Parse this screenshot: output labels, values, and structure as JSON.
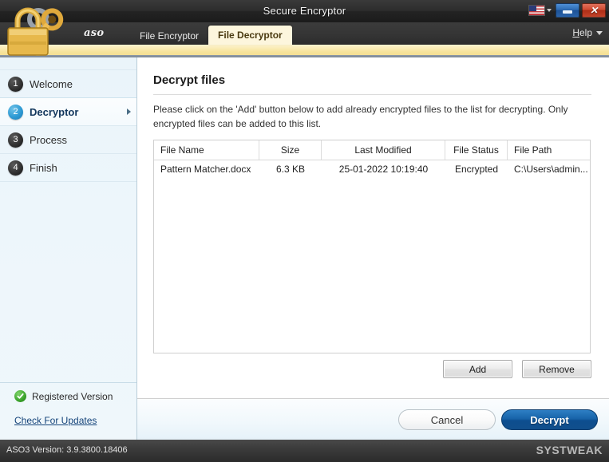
{
  "window": {
    "title": "Secure Encryptor",
    "minimize_label": "–",
    "close_label": "✕",
    "flag_icon": "us-flag-icon"
  },
  "tabbar": {
    "brand": "aso",
    "tabs": [
      {
        "label": "File Encryptor",
        "active": false
      },
      {
        "label": "File Decryptor",
        "active": true
      }
    ],
    "help_label": "Help"
  },
  "sidebar": {
    "steps": [
      {
        "num": "1",
        "label": "Welcome",
        "active": false
      },
      {
        "num": "2",
        "label": "Decryptor",
        "active": true
      },
      {
        "num": "3",
        "label": "Process",
        "active": false
      },
      {
        "num": "4",
        "label": "Finish",
        "active": false
      }
    ],
    "registered_label": "Registered Version",
    "updates_link": "Check For Updates"
  },
  "main": {
    "heading": "Decrypt files",
    "description": "Please click on the 'Add' button below to add already encrypted files to the list for decrypting. Only encrypted files can be added to this list.",
    "table": {
      "columns": [
        "File Name",
        "Size",
        "Last Modified",
        "File Status",
        "File Path"
      ],
      "rows": [
        {
          "file_name": "Pattern Matcher.docx",
          "size": "6.3 KB",
          "last_modified": "25-01-2022 10:19:40",
          "file_status": "Encrypted",
          "file_path": "C:\\Users\\admin..."
        }
      ]
    },
    "add_label": "Add",
    "remove_label": "Remove"
  },
  "actions": {
    "cancel_label": "Cancel",
    "primary_label": "Decrypt"
  },
  "statusbar": {
    "version_text": "ASO3 Version: 3.9.3800.18406",
    "vendor": "SYSTWEAK"
  },
  "colors": {
    "accent_blue": "#1763a8",
    "tab_active_bg": "#fdf6dd",
    "gold_band": "#f7e49c",
    "sidebar_bg": "#edf6fb",
    "titlebar_bg": "#2c2c2c",
    "close_red": "#cf4a31",
    "link_blue": "#15447a",
    "registered_green": "#3ba32c"
  }
}
